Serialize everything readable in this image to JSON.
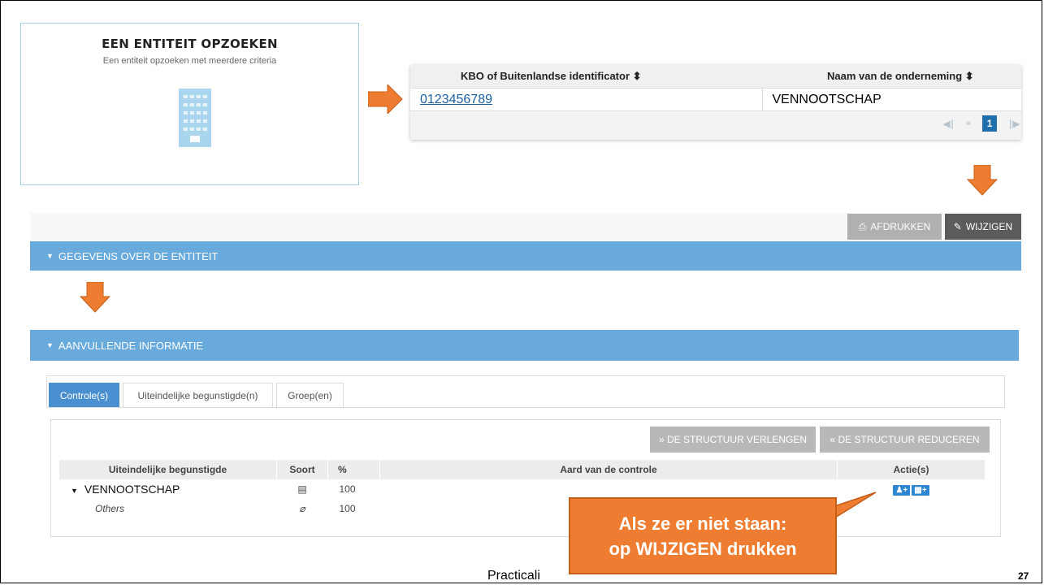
{
  "search_card": {
    "title": "EEN ENTITEIT OPZOEKEN",
    "subtitle": "Een entiteit opzoeken met meerdere criteria",
    "icon": "building-icon"
  },
  "result_table": {
    "columns": [
      "KBO of Buitenlandse identificator ⬍",
      "Naam van de onderneming ⬍"
    ],
    "rows": [
      {
        "id": "0123456789",
        "name": "VENNOOTSCHAP"
      }
    ],
    "pager": {
      "first": "◀∣",
      "prev": "«",
      "current": "1",
      "next": "∣▶"
    }
  },
  "toolbar": {
    "print_label": "AFDRUKKEN",
    "edit_label": "WIJZIGEN"
  },
  "sections": {
    "entity": "GEGEVENS OVER DE ENTITEIT",
    "extra": "AANVULLENDE INFORMATIE"
  },
  "tabs": [
    "Controle(s)",
    "Uiteindelijke begunstigde(n)",
    "Groep(en)"
  ],
  "structure_buttons": {
    "extend": "» DE STRUCTUUR VERLENGEN",
    "reduce": "« DE STRUCTUUR REDUCEREN"
  },
  "control_table": {
    "headers": [
      "Uiteindelijke begunstigde",
      "Soort",
      "%",
      "Aard van de controle",
      "Actie(s)"
    ],
    "rows": [
      {
        "name": "VENNOOTSCHAP",
        "soort": "▤",
        "pct": "100",
        "aard": ""
      },
      {
        "name": "Others",
        "soort": "⌀",
        "pct": "100",
        "aard": ""
      }
    ]
  },
  "callout": {
    "line1": "Als ze er niet staan:",
    "line2": "op WIJZIGEN drukken"
  },
  "footer": {
    "text": "Practicali",
    "page": "27"
  },
  "colors": {
    "accent_orange": "#ee7d31",
    "section_blue": "#69aadd",
    "link_blue": "#1c5fa3"
  }
}
